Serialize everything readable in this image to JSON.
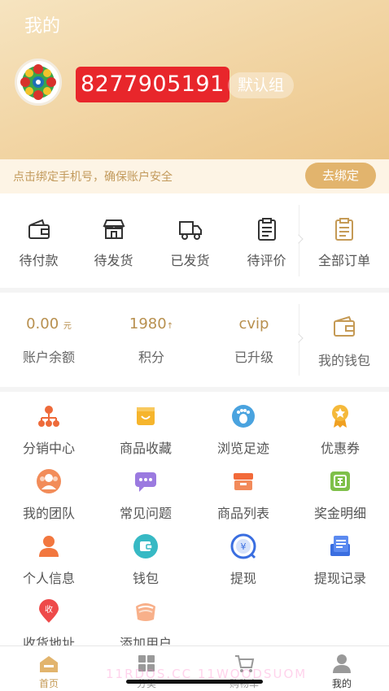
{
  "header": {
    "title": "我的",
    "username": "8277905191",
    "group": "默认组"
  },
  "bind_phone": {
    "text": "点击绑定手机号，确保账户安全",
    "button": "去绑定"
  },
  "orders": [
    {
      "label": "待付款",
      "icon": "wallet-icon"
    },
    {
      "label": "待发货",
      "icon": "store-icon"
    },
    {
      "label": "已发货",
      "icon": "truck-icon"
    },
    {
      "label": "待评价",
      "icon": "clipboard-icon"
    },
    {
      "label": "全部订单",
      "icon": "order-list-icon"
    }
  ],
  "wallet": {
    "balance_value": "0.00",
    "balance_unit": "元",
    "balance_label": "账户余额",
    "points_value": "1980",
    "points_label": "积分",
    "level_value": "cvip",
    "level_label": "已升级",
    "my_wallet_label": "我的钱包"
  },
  "services": [
    {
      "label": "分销中心",
      "icon": "org-chart-icon"
    },
    {
      "label": "商品收藏",
      "icon": "smile-bag-icon"
    },
    {
      "label": "浏览足迹",
      "icon": "footprint-icon"
    },
    {
      "label": "优惠券",
      "icon": "medal-icon"
    },
    {
      "label": "我的团队",
      "icon": "team-icon"
    },
    {
      "label": "常见问题",
      "icon": "chat-icon"
    },
    {
      "label": "商品列表",
      "icon": "shop-list-icon"
    },
    {
      "label": "奖金明细",
      "icon": "bonus-icon"
    },
    {
      "label": "个人信息",
      "icon": "person-icon"
    },
    {
      "label": "钱包",
      "icon": "wallet-round-icon"
    },
    {
      "label": "提现",
      "icon": "withdraw-icon"
    },
    {
      "label": "提现记录",
      "icon": "record-icon"
    },
    {
      "label": "收货地址",
      "icon": "location-icon"
    },
    {
      "label": "添加用户",
      "icon": "add-user-icon"
    }
  ],
  "tabbar": [
    {
      "label": "首页",
      "icon": "home-icon"
    },
    {
      "label": "分类",
      "icon": "category-icon"
    },
    {
      "label": "购物车",
      "icon": "cart-icon"
    },
    {
      "label": "我的",
      "icon": "profile-icon"
    }
  ],
  "watermark": "11RDOS.CC  11WOODSUOM",
  "colors": {
    "accent_gold": "#c59a55",
    "badge_red": "#e8262b",
    "header_gold": "#f2d6a6"
  }
}
